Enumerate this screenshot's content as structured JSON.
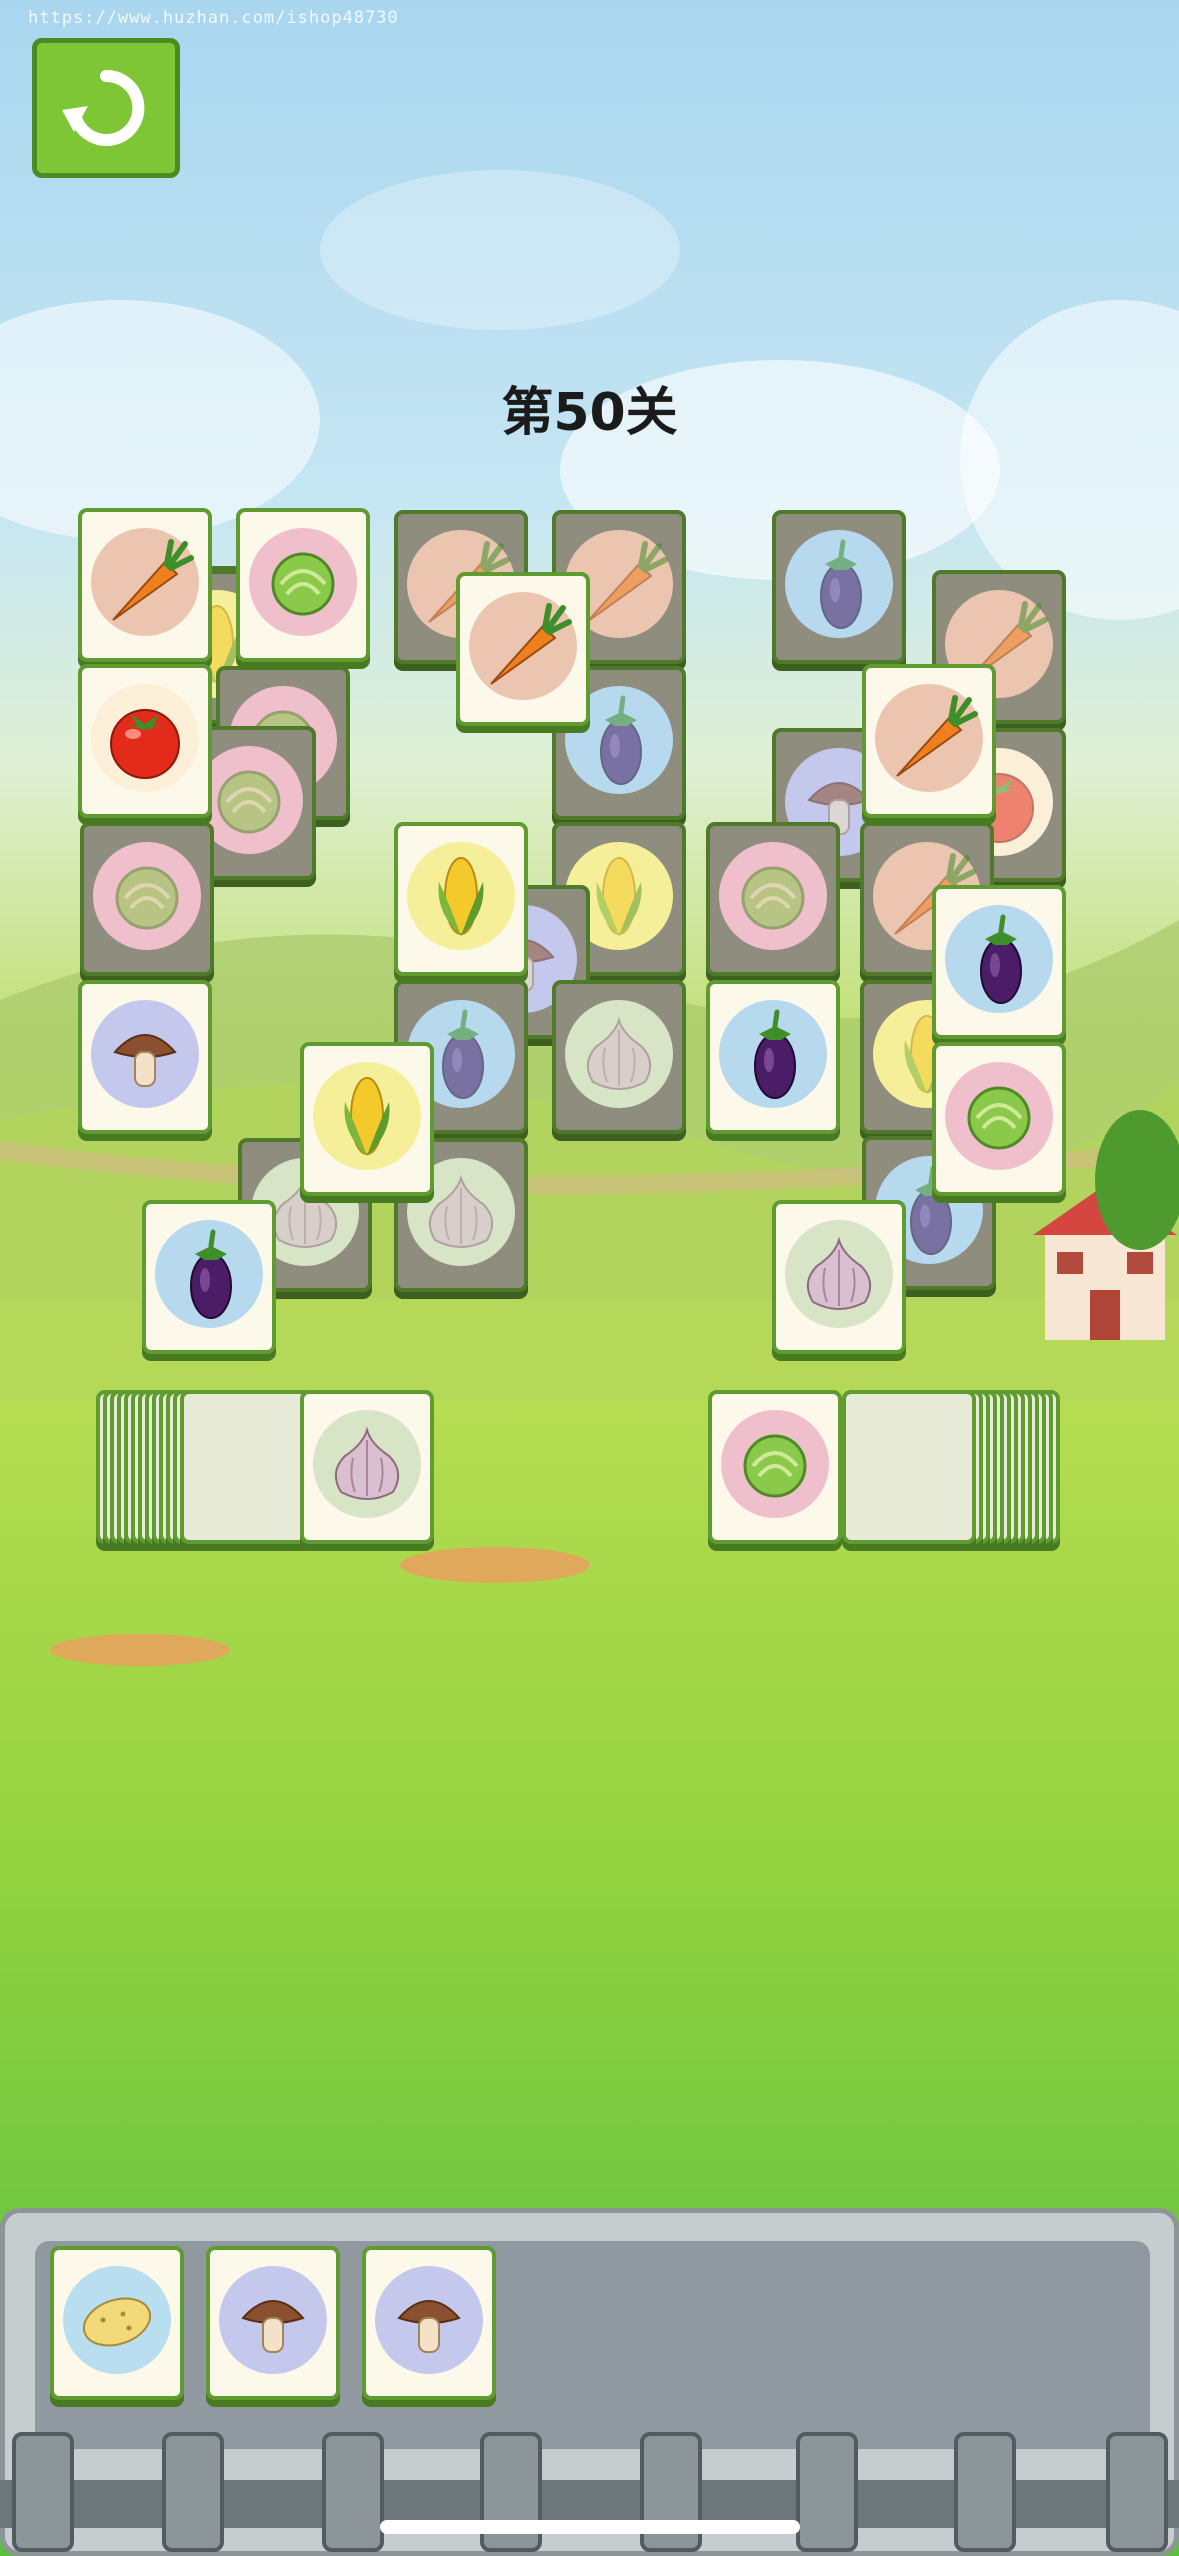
{
  "watermark": {
    "url": "https://www.huzhan.com/ishop48730"
  },
  "header": {
    "level_title": "第50关"
  },
  "icons": {
    "restart": "restart-icon"
  },
  "vegetable_colors": {
    "carrot": "#f07f1d",
    "lettuce": "#8bc94a",
    "tomato": "#e22b1a",
    "eggplant": "#4a1d66",
    "corn": "#f4c92c",
    "mushroom": "#8a5030",
    "garlic": "#d9bfd0",
    "potato": "#f2d97a"
  },
  "board": {
    "tiles": [
      {
        "veg": "carrot",
        "state": "covered"
      },
      {
        "veg": "carrot",
        "state": "covered"
      },
      {
        "veg": "carrot",
        "state": "covered"
      },
      {
        "veg": "eggplant",
        "state": "covered"
      },
      {
        "veg": "carrot",
        "state": "covered"
      },
      {
        "veg": "corn",
        "state": "covered"
      },
      {
        "veg": "lettuce",
        "state": "covered"
      },
      {
        "veg": "lettuce",
        "state": "covered"
      },
      {
        "veg": "eggplant",
        "state": "covered"
      },
      {
        "veg": "mushroom",
        "state": "covered"
      },
      {
        "veg": "tomato",
        "state": "covered"
      },
      {
        "veg": "lettuce",
        "state": "covered"
      },
      {
        "veg": "corn",
        "state": "covered"
      },
      {
        "veg": "lettuce",
        "state": "covered"
      },
      {
        "veg": "carrot",
        "state": "covered"
      },
      {
        "veg": "mushroom",
        "state": "covered"
      },
      {
        "veg": "eggplant",
        "state": "covered"
      },
      {
        "veg": "garlic",
        "state": "covered"
      },
      {
        "veg": "corn",
        "state": "covered"
      },
      {
        "veg": "eggplant",
        "state": "covered"
      },
      {
        "veg": "garlic",
        "state": "covered"
      },
      {
        "veg": "garlic",
        "state": "covered"
      },
      {
        "veg": "carrot",
        "state": "free"
      },
      {
        "veg": "lettuce",
        "state": "free"
      },
      {
        "veg": "carrot",
        "state": "free"
      },
      {
        "veg": "tomato",
        "state": "free"
      },
      {
        "veg": "carrot",
        "state": "free"
      },
      {
        "veg": "corn",
        "state": "free"
      },
      {
        "veg": "eggplant",
        "state": "free"
      },
      {
        "veg": "mushroom",
        "state": "free"
      },
      {
        "veg": "eggplant",
        "state": "free"
      },
      {
        "veg": "corn",
        "state": "free"
      },
      {
        "veg": "lettuce",
        "state": "free"
      },
      {
        "veg": "eggplant",
        "state": "free"
      },
      {
        "veg": "garlic",
        "state": "free"
      }
    ],
    "left_stack_top": {
      "veg": "garlic",
      "state": "free"
    },
    "right_stack_top": {
      "veg": "lettuce",
      "state": "free"
    }
  },
  "collection_bar": {
    "slots": [
      {
        "veg": "potato"
      },
      {
        "veg": "mushroom"
      },
      {
        "veg": "mushroom"
      }
    ]
  }
}
